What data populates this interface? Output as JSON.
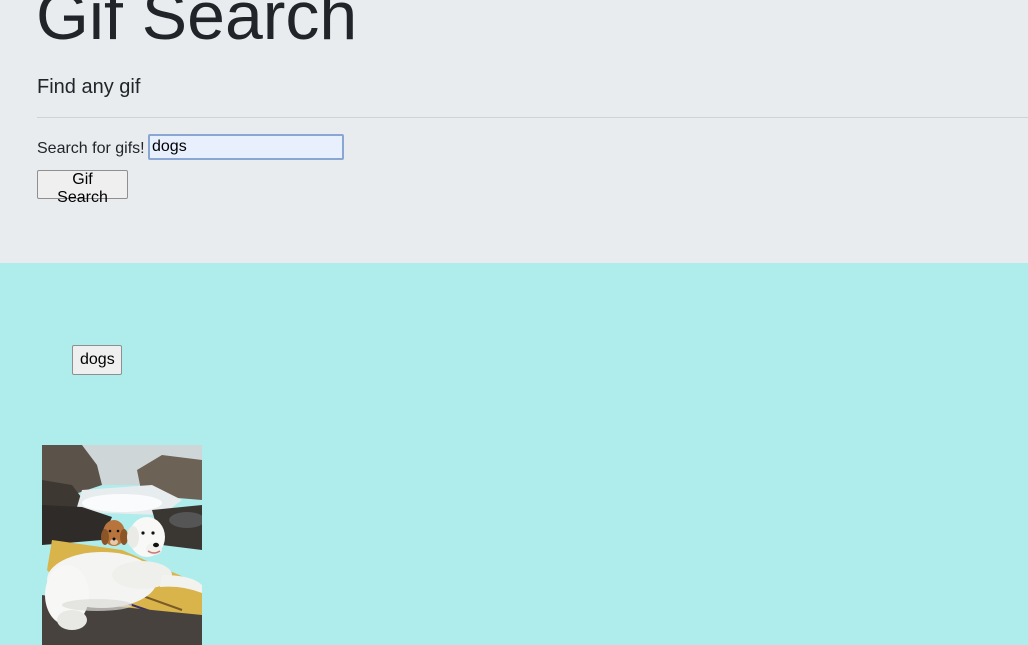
{
  "header": {
    "title": "Gif Search",
    "subtitle": "Find any gif"
  },
  "search": {
    "label": "Search for gifs!",
    "value": "dogs",
    "button_label": "Gif Search"
  },
  "results": {
    "topics": [
      "dogs"
    ],
    "gif_alt": "dogs"
  },
  "colors": {
    "header_bg": "#e9ecef",
    "results_bg": "#afecec"
  }
}
